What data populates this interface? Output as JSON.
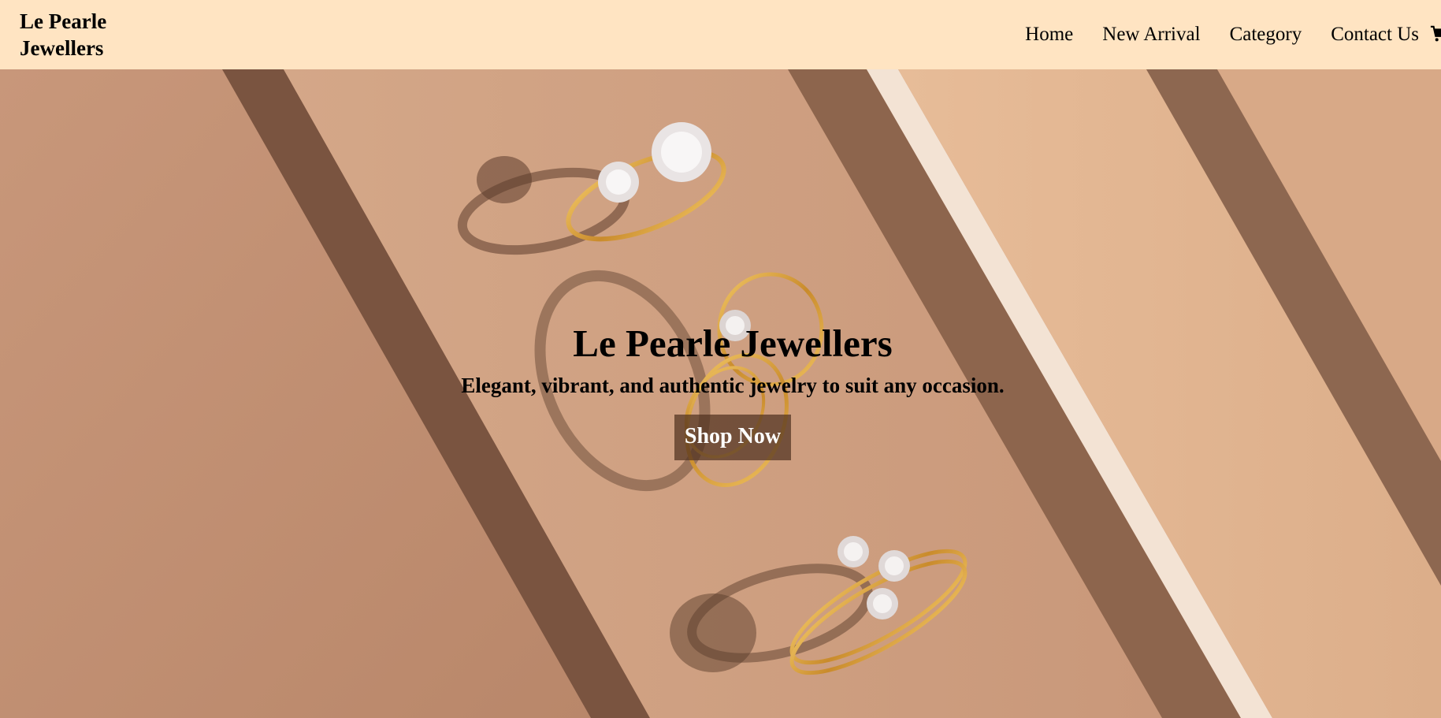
{
  "brand": {
    "name": "Le Pearle\nJewellers"
  },
  "nav": {
    "items": [
      {
        "label": "Home"
      },
      {
        "label": "New Arrival"
      },
      {
        "label": "Category"
      },
      {
        "label": "Contact Us"
      }
    ],
    "cart_icon": "cart-icon"
  },
  "hero": {
    "title": "Le Pearle Jewellers",
    "subtitle": "Elegant, vibrant, and authentic jewelry to suit any occasion.",
    "cta_label": "Shop Now"
  },
  "colors": {
    "navbar_bg": "#ffe4c2",
    "hero_bg": "#c69373",
    "cta_bg": "#503220"
  }
}
